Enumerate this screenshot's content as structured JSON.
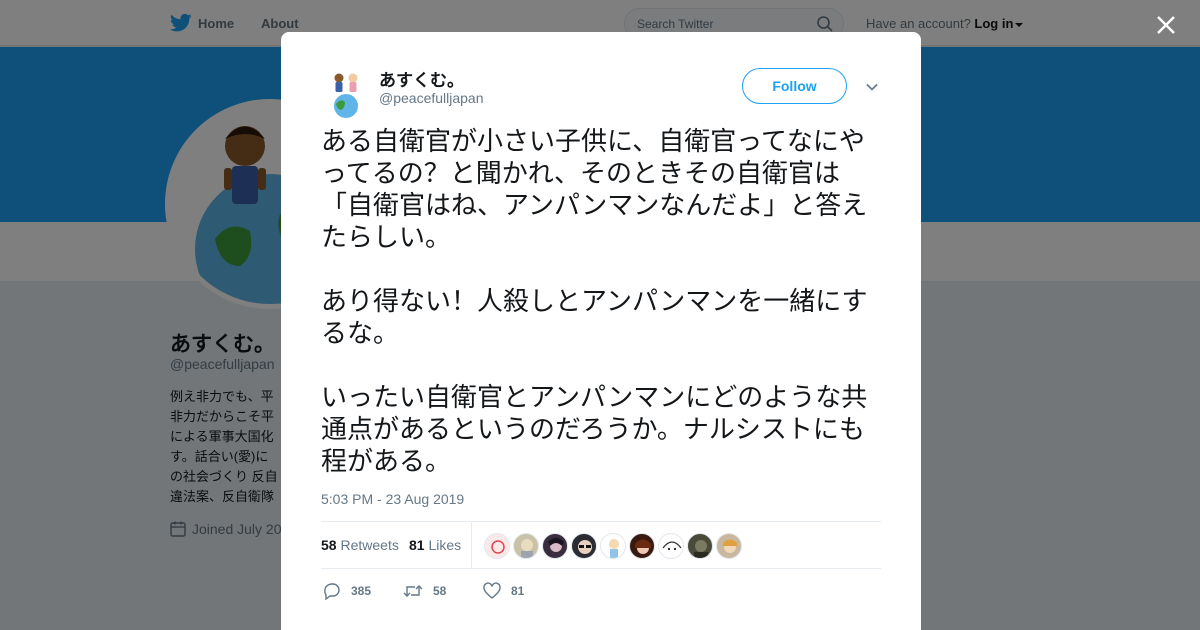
{
  "nav": {
    "home_label": "Home",
    "about_label": "About",
    "search_placeholder": "Search Twitter",
    "have_account": "Have an account?",
    "login_label": "Log in"
  },
  "profile": {
    "name": "あすくむ。",
    "handle": "@peacefulljapan",
    "bio": "例え非力でも、平\n非力だからこそ平\nによる軍事大国化\nす。話合い(愛)に\nの社会づくり 反自\n違法案、反自衛隊",
    "joined": "Joined July 20"
  },
  "tweet": {
    "author_name": "あすくむ。",
    "author_handle": "@peacefulljapan",
    "follow_label": "Follow",
    "paragraphs": [
      "ある自衛官が小さい子供に、自衛官ってなにやってるの？と聞かれ、そのときその自衛官は「自衛官はね、アンパンマンなんだよ」と答えたらしい。",
      "あり得ない！人殺しとアンパンマンを一緒にするな。",
      "いったい自衛官とアンパンマンにどのような共通点があるというのだろうか。ナルシストにも程がある。"
    ],
    "timestamp": "5:03 PM - 23 Aug 2019",
    "retweets_count": "58",
    "retweets_label": "Retweets",
    "likes_count": "81",
    "likes_label": "Likes",
    "reply_count": "385",
    "retweet_action_count": "58",
    "like_action_count": "81"
  },
  "colors": {
    "accent": "#1da1f2",
    "banner": "#1da1f2",
    "text_primary": "#14171a",
    "text_secondary": "#657786"
  },
  "icons": [
    "twitter-bird-icon",
    "search-icon",
    "close-icon",
    "chevron-down-icon",
    "calendar-icon",
    "reply-icon",
    "retweet-icon",
    "heart-icon"
  ]
}
